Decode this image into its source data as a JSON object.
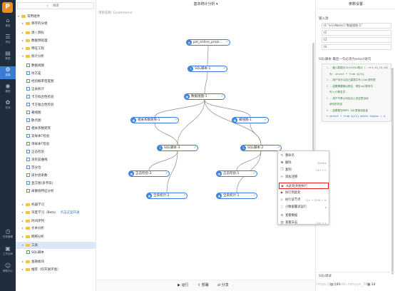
{
  "nav": {
    "logo": "P",
    "items": [
      {
        "icon": "⌂",
        "label": "首页"
      },
      {
        "icon": "☰",
        "label": "项目"
      },
      {
        "icon": "▤",
        "label": "数据"
      },
      {
        "icon": "⚙",
        "label": "实验"
      },
      {
        "icon": "◉",
        "label": "模型"
      },
      {
        "icon": "✿",
        "label": "在线"
      }
    ],
    "bottom": [
      {
        "icon": "◷",
        "label": "任务管理"
      },
      {
        "icon": "▣",
        "label": "工作空间"
      },
      {
        "icon": "☺",
        "label": "帮助中心"
      }
    ]
  },
  "tree": {
    "search_placeholder": "搜索",
    "items": [
      {
        "label": "常用组件",
        "type": "folder",
        "open": true
      },
      {
        "label": "保存的分组",
        "type": "folder",
        "indent": 1
      },
      {
        "label": "源 / 目标",
        "type": "folder",
        "indent": 1
      },
      {
        "label": "数据预处理",
        "type": "folder",
        "indent": 1
      },
      {
        "label": "特征工程",
        "type": "folder",
        "indent": 1
      },
      {
        "label": "统计分析",
        "type": "folder",
        "open": true,
        "indent": 1
      },
      {
        "label": "数据视图",
        "type": "leaf",
        "indent": 2
      },
      {
        "label": "协方差",
        "type": "leaf",
        "indent": 2
      },
      {
        "label": "经验概率密度图",
        "type": "leaf",
        "indent": 2
      },
      {
        "label": "全表统计",
        "type": "leaf",
        "indent": 2
      },
      {
        "label": "卡方拟合性检验",
        "type": "leaf",
        "indent": 2
      },
      {
        "label": "卡方独立性检验",
        "type": "leaf",
        "indent": 2
      },
      {
        "label": "箱线图",
        "type": "leaf",
        "indent": 2
      },
      {
        "label": "散点图",
        "type": "leaf",
        "indent": 2
      },
      {
        "label": "相关系数矩阵",
        "type": "leaf",
        "indent": 2
      },
      {
        "label": "双样本T检验",
        "type": "leaf",
        "indent": 2
      },
      {
        "label": "单样本T检验",
        "type": "leaf",
        "indent": 2
      },
      {
        "label": "正态检验",
        "type": "leaf",
        "indent": 2
      },
      {
        "label": "洛伦兹曲线",
        "type": "leaf",
        "indent": 2
      },
      {
        "label": "百分位",
        "type": "leaf",
        "indent": 2
      },
      {
        "label": "皮尔逊系数",
        "type": "leaf",
        "indent": 2
      },
      {
        "label": "直方图(多字段)",
        "type": "leaf",
        "indent": 2
      },
      {
        "label": "离散值特征分析",
        "type": "leaf",
        "indent": 2
      },
      {
        "label": "机器学习",
        "type": "folder",
        "indent": 1
      },
      {
        "label": "深度学习（Beta）",
        "type": "folder",
        "indent": 1,
        "extra": "点击这里开通"
      },
      {
        "label": "时间序列",
        "type": "folder",
        "indent": 1
      },
      {
        "label": "文本分析",
        "type": "folder",
        "indent": 1
      },
      {
        "label": "网络分析",
        "type": "folder",
        "indent": 1
      },
      {
        "label": "工具",
        "type": "folder",
        "open": true,
        "indent": 1,
        "selected": true
      },
      {
        "label": "SQL脚本",
        "type": "leaf",
        "indent": 2
      },
      {
        "label": "金融板块",
        "type": "folder",
        "indent": 1
      },
      {
        "label": "推荐（仅开发环境）",
        "type": "folder",
        "indent": 1
      }
    ]
  },
  "canvas": {
    "title": "基本统计分析",
    "breadcrumb": "项目名称: Ecommerce",
    "nodes": [
      {
        "id": "n0",
        "label": "pai_online_proje...",
        "icon": "▤"
      },
      {
        "id": "n1",
        "label": "SQL脚本-1",
        "icon": "S"
      },
      {
        "id": "n2",
        "label": "数据视图-1",
        "icon": "▦"
      },
      {
        "id": "n3",
        "label": "相关系数矩阵-1",
        "icon": "▦"
      },
      {
        "id": "n4",
        "label": "箱线图-1",
        "icon": "▦"
      },
      {
        "id": "n5",
        "label": "SQL脚本-3",
        "icon": "S"
      },
      {
        "id": "n6",
        "label": "SQL脚本-2",
        "icon": "S"
      },
      {
        "id": "n7",
        "label": "正态检验-2",
        "icon": "▦"
      },
      {
        "id": "n8",
        "label": "正态检验-1",
        "icon": "▦"
      },
      {
        "id": "n9",
        "label": "全表统计-2",
        "icon": "▦"
      },
      {
        "id": "n10",
        "label": "全表统计-1",
        "icon": "▦"
      }
    ],
    "context_menu": [
      {
        "icon": "✎",
        "label": "重命名",
        "shortcut": ""
      },
      {
        "icon": "✖",
        "label": "删除",
        "shortcut": "Delete"
      },
      {
        "icon": "❐",
        "label": "复制",
        "shortcut": "Ctrl + C"
      },
      {
        "icon": "✍",
        "label": "添加注释",
        "shortcut": ""
      },
      {
        "icon": "▶",
        "label": "从此处开始执行",
        "shortcut": "",
        "highlight": true
      },
      {
        "icon": "▶",
        "label": "执行到此处",
        "shortcut": ""
      },
      {
        "icon": "▷",
        "label": "执行该节点",
        "shortcut": "Ctrl + Shift + N"
      },
      {
        "icon": "◌",
        "label": "小数据量试运行",
        "shortcut": "▸"
      },
      {
        "icon": "☰",
        "label": "查看数据",
        "shortcut": ""
      },
      {
        "icon": "▤",
        "label": "查看日志",
        "shortcut": "Ctrl + L"
      }
    ],
    "toolbar": {
      "run": "运行",
      "deploy": "部署",
      "share": "分享"
    }
  },
  "panel": {
    "title": "参数设置",
    "inputs_label": "输入源",
    "inputs": [
      "t1  \"${inName}\"数据视图-1\"",
      "t2",
      "t3",
      "t4"
    ],
    "sql_label": "SQL脚本  最后一句必须为select语句",
    "code": [
      {
        "n": "1",
        "text": "--输入数据以t1t2t3t4表示（-->t1,t2,t3,t4），使用方式",
        "type": "comment"
      },
      {
        "n": "",
        "text": "为: select * from ${t1}",
        "type": "comment"
      },
      {
        "n": "2",
        "text": "--用户也可以自己建表并写入Sql语句里",
        "type": "comment"
      },
      {
        "n": "3",
        "text": "--如果需要输出表名，请在sql脚本中",
        "type": "comment"
      },
      {
        "n": "",
        "text": "写入t1等名字",
        "type": "comment"
      },
      {
        "n": "4",
        "text": "--用户不是公司站点上说这里自动",
        "type": "comment"
      },
      {
        "n": "",
        "text": "填写的内容",
        "type": "comment"
      },
      {
        "n": "5",
        "text": "--如果要在MOPS SQL里使用变量",
        "type": "comment"
      },
      {
        "n": "6",
        "text": "select * from ${t1} where region = 4",
        "type": "code"
      }
    ],
    "footer_label": "SQL调试",
    "count1": "140",
    "count2": "14"
  },
  "watermark": "https://blog.csdn.net/yyn_365"
}
